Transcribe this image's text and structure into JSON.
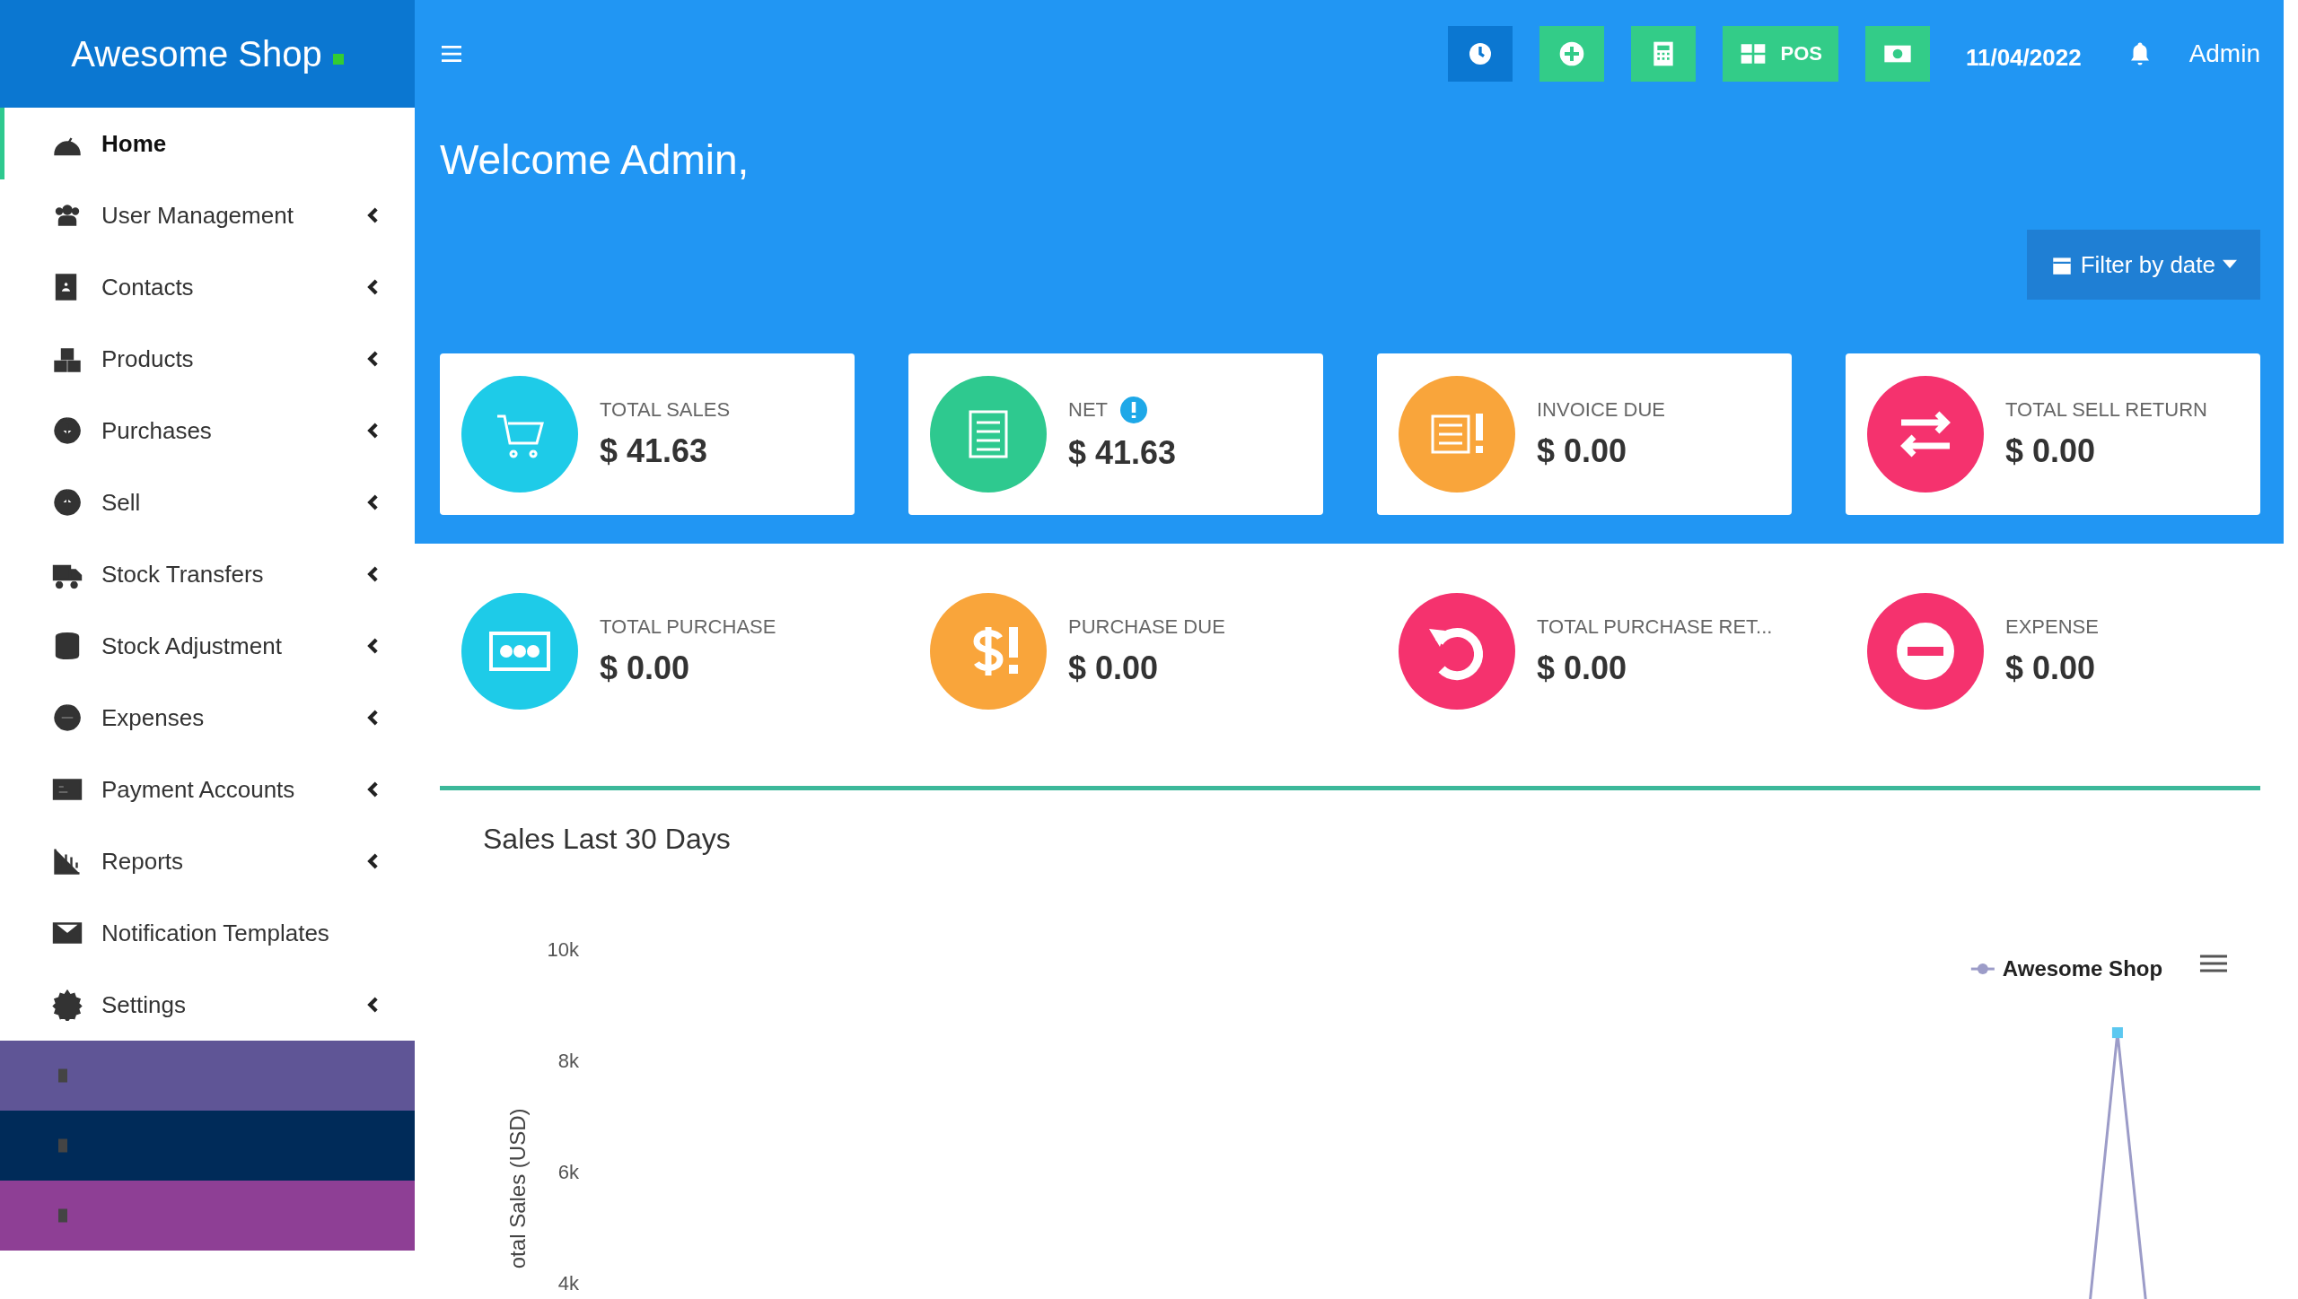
{
  "brand": {
    "name": "Awesome Shop"
  },
  "sidebar": {
    "items": [
      {
        "label": "Home",
        "selected": true,
        "has_submenu": false
      },
      {
        "label": "User Management",
        "selected": false,
        "has_submenu": true
      },
      {
        "label": "Contacts",
        "selected": false,
        "has_submenu": true
      },
      {
        "label": "Products",
        "selected": false,
        "has_submenu": true
      },
      {
        "label": "Purchases",
        "selected": false,
        "has_submenu": true
      },
      {
        "label": "Sell",
        "selected": false,
        "has_submenu": true
      },
      {
        "label": "Stock Transfers",
        "selected": false,
        "has_submenu": true
      },
      {
        "label": "Stock Adjustment",
        "selected": false,
        "has_submenu": true
      },
      {
        "label": "Expenses",
        "selected": false,
        "has_submenu": true
      },
      {
        "label": "Payment Accounts",
        "selected": false,
        "has_submenu": true
      },
      {
        "label": "Reports",
        "selected": false,
        "has_submenu": true
      },
      {
        "label": "Notification Templates",
        "selected": false,
        "has_submenu": false
      },
      {
        "label": "Settings",
        "selected": false,
        "has_submenu": true
      }
    ],
    "extra_items": [
      {
        "color": "#5f5596"
      },
      {
        "color": "#002b59"
      },
      {
        "color": "#8e3f95"
      }
    ]
  },
  "topbar": {
    "pos_label": "POS",
    "date": "11/04/2022",
    "user": "Admin"
  },
  "welcome": "Welcome Admin,",
  "filter_button": "Filter by date",
  "highlight_stats": [
    {
      "label": "TOTAL SALES",
      "value": "$ 41.63",
      "info": false,
      "color": "#1ecbe8"
    },
    {
      "label": "NET",
      "value": "$ 41.63",
      "info": true,
      "color": "#2ec98f"
    },
    {
      "label": "INVOICE DUE",
      "value": "$ 0.00",
      "info": false,
      "color": "#f9a53b"
    },
    {
      "label": "TOTAL SELL RETURN",
      "value": "$ 0.00",
      "info": false,
      "color": "#f5326e"
    }
  ],
  "stats": [
    {
      "label": "TOTAL PURCHASE",
      "value": "$ 0.00",
      "color": "#1ecbe8"
    },
    {
      "label": "PURCHASE DUE",
      "value": "$ 0.00",
      "color": "#f9a53b"
    },
    {
      "label": "TOTAL PURCHASE RET...",
      "value": "$ 0.00",
      "color": "#f5326e"
    },
    {
      "label": "EXPENSE",
      "value": "$ 0.00",
      "color": "#f5326e"
    }
  ],
  "sales_panel": {
    "title": "Sales Last 30 Days",
    "y_axis_title": "otal Sales (USD)",
    "y_tick_labels": [
      "10k",
      "8k",
      "6k",
      "4k"
    ],
    "legend": "Awesome Shop"
  }
}
